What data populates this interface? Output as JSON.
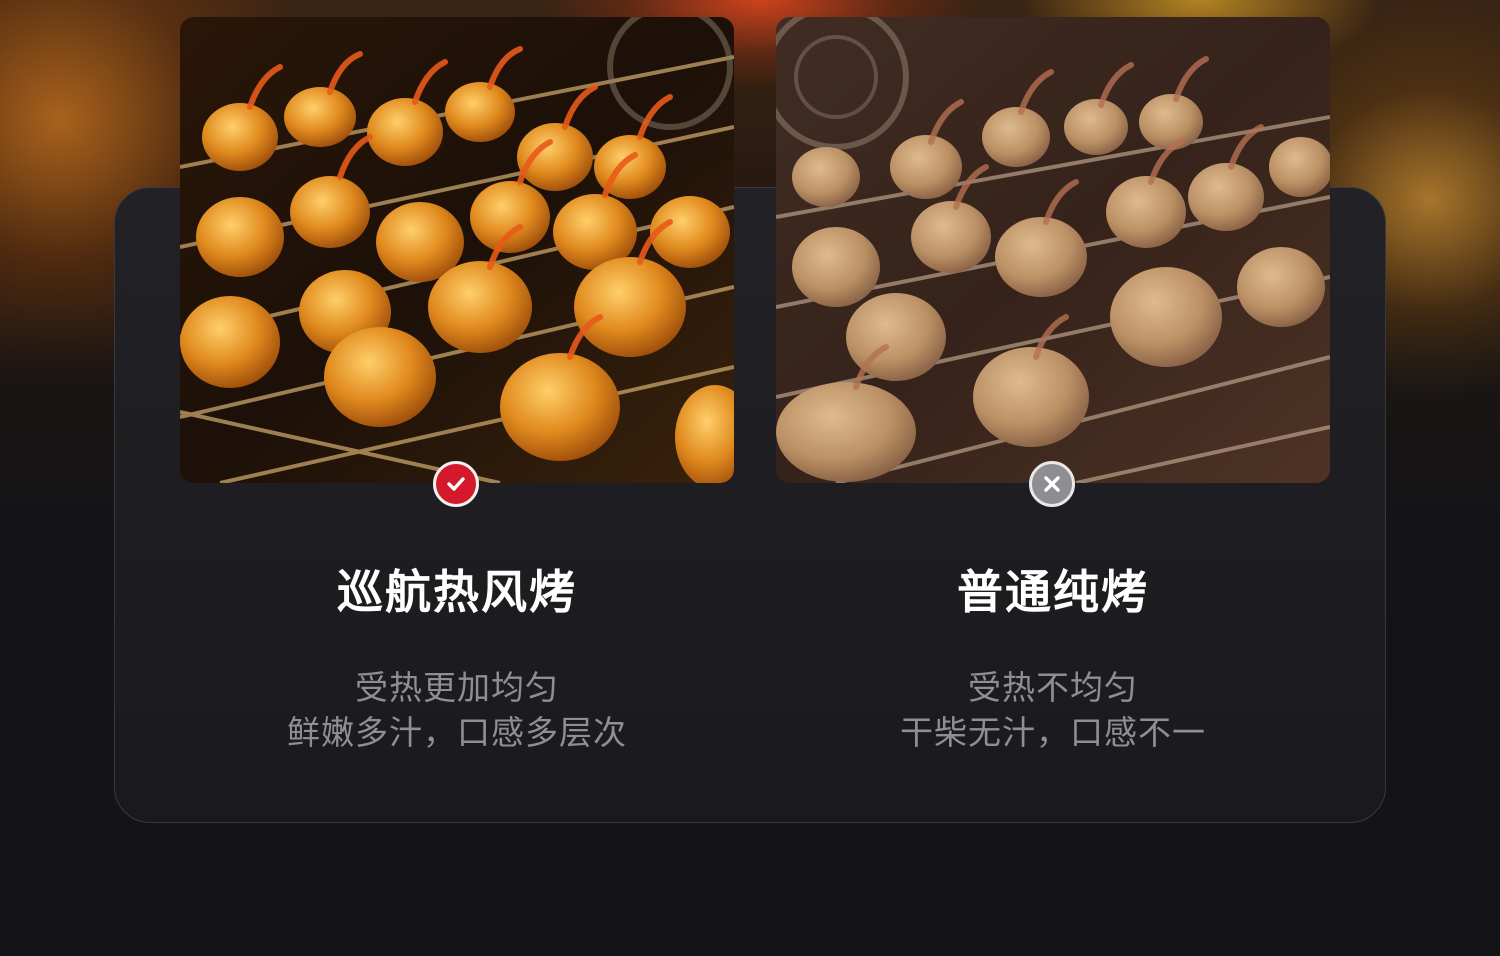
{
  "comparison": {
    "left": {
      "title": "巡航热风烤",
      "line1": "受热更加均匀",
      "line2": "鲜嫩多汁，口感多层次",
      "badge_icon": "check-icon",
      "badge_color": "#d4192b"
    },
    "right": {
      "title": "普通纯烤",
      "line1": "受热不均匀",
      "line2": "干柴无汁，口感不一",
      "badge_icon": "cross-icon",
      "badge_color": "#8e8e92"
    }
  }
}
